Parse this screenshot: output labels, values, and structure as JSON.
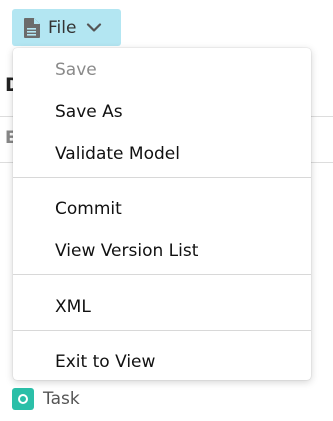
{
  "toolbar": {
    "file_label": "File"
  },
  "background": {
    "title": "D",
    "subtitle": "E",
    "task_label": "Task"
  },
  "menu": {
    "items": [
      {
        "label": "Save",
        "enabled": false
      },
      {
        "label": "Save As",
        "enabled": true
      },
      {
        "label": "Validate Model",
        "enabled": true
      },
      {
        "label": "Commit",
        "enabled": true
      },
      {
        "label": "View Version List",
        "enabled": true
      },
      {
        "label": "XML",
        "enabled": true
      },
      {
        "label": "Exit to View",
        "enabled": true
      }
    ]
  },
  "colors": {
    "file_button_bg": "#b3e6f2",
    "task_icon": "#2bbfa8"
  },
  "icons": {
    "file": "document-icon",
    "dropdown": "chevron-down-icon",
    "task": "task-icon"
  }
}
